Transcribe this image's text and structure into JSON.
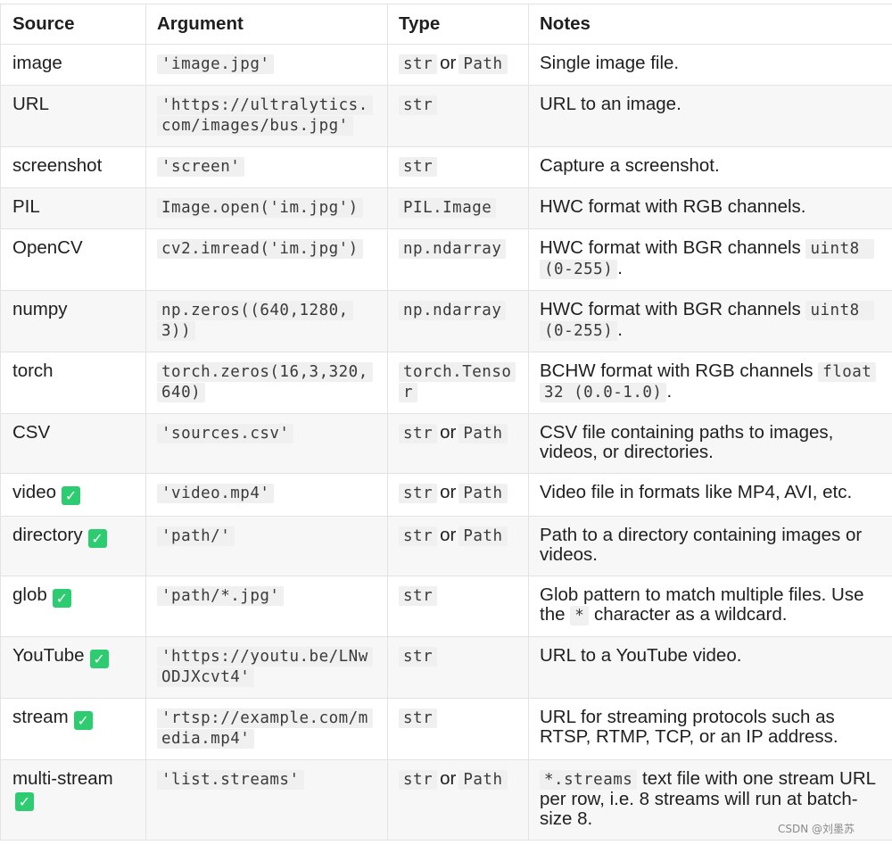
{
  "table": {
    "headers": [
      "Source",
      "Argument",
      "Type",
      "Notes"
    ],
    "or_word": "or",
    "rows": [
      {
        "source": "image",
        "argument": "'image.jpg'",
        "types": [
          "str",
          "Path"
        ],
        "notes": [
          {
            "t": "text",
            "v": "Single image file."
          }
        ]
      },
      {
        "source": "URL",
        "argument": "'https://ultralytics.com/images/bus.jpg'",
        "types": [
          "str"
        ],
        "notes": [
          {
            "t": "text",
            "v": "URL to an image."
          }
        ]
      },
      {
        "source": "screenshot",
        "argument": "'screen'",
        "types": [
          "str"
        ],
        "notes": [
          {
            "t": "text",
            "v": "Capture a screenshot."
          }
        ]
      },
      {
        "source": "PIL",
        "argument": "Image.open('im.jpg')",
        "types": [
          "PIL.Image"
        ],
        "notes": [
          {
            "t": "text",
            "v": "HWC format with RGB channels."
          }
        ]
      },
      {
        "source": "OpenCV",
        "argument": "cv2.imread('im.jpg')",
        "types": [
          "np.ndarray"
        ],
        "notes": [
          {
            "t": "text",
            "v": "HWC format with BGR channels "
          },
          {
            "t": "code",
            "v": "uint8 (0-255)"
          },
          {
            "t": "text",
            "v": "."
          }
        ]
      },
      {
        "source": "numpy",
        "argument": "np.zeros((640,1280,3))",
        "types": [
          "np.ndarray"
        ],
        "notes": [
          {
            "t": "text",
            "v": "HWC format with BGR channels "
          },
          {
            "t": "code",
            "v": "uint8 (0-255)"
          },
          {
            "t": "text",
            "v": "."
          }
        ]
      },
      {
        "source": "torch",
        "argument": "torch.zeros(16,3,320,640)",
        "types": [
          "torch.Tensor"
        ],
        "notes": [
          {
            "t": "text",
            "v": "BCHW format with RGB channels "
          },
          {
            "t": "code",
            "v": "float32 (0.0-1.0)"
          },
          {
            "t": "text",
            "v": "."
          }
        ]
      },
      {
        "source": "CSV",
        "argument": "'sources.csv'",
        "types": [
          "str",
          "Path"
        ],
        "notes": [
          {
            "t": "text",
            "v": "CSV file containing paths to images, videos, or directories."
          }
        ]
      },
      {
        "source": "video",
        "check": true,
        "argument": "'video.mp4'",
        "types": [
          "str",
          "Path"
        ],
        "notes": [
          {
            "t": "text",
            "v": "Video file in formats like MP4, AVI, etc."
          }
        ]
      },
      {
        "source": "directory",
        "check": true,
        "argument": "'path/'",
        "types": [
          "str",
          "Path"
        ],
        "notes": [
          {
            "t": "text",
            "v": "Path to a directory containing images or videos."
          }
        ]
      },
      {
        "source": "glob",
        "check": true,
        "argument": "'path/*.jpg'",
        "types": [
          "str"
        ],
        "notes": [
          {
            "t": "text",
            "v": "Glob pattern to match multiple files. Use the "
          },
          {
            "t": "code",
            "v": "*"
          },
          {
            "t": "text",
            "v": " character as a wildcard."
          }
        ]
      },
      {
        "source": "YouTube",
        "check": true,
        "argument": "'https://youtu.be/LNwODJXcvt4'",
        "types": [
          "str"
        ],
        "notes": [
          {
            "t": "text",
            "v": "URL to a YouTube video."
          }
        ]
      },
      {
        "source": "stream",
        "check": true,
        "argument": "'rtsp://example.com/media.mp4'",
        "types": [
          "str"
        ],
        "notes": [
          {
            "t": "text",
            "v": "URL for streaming protocols such as RTSP, RTMP, TCP, or an IP address."
          }
        ]
      },
      {
        "source": "multi-stream",
        "check": true,
        "check_block": true,
        "argument": "'list.streams'",
        "types": [
          "str",
          "Path"
        ],
        "notes": [
          {
            "t": "code",
            "v": "*.streams"
          },
          {
            "t": "text",
            "v": " text file with one stream URL per row, i.e. 8 streams will run at batch-size 8."
          }
        ]
      }
    ]
  },
  "check_icon": {
    "name": "checkmark-icon",
    "glyph": "✓",
    "color": "#2ecc71"
  },
  "watermark": "CSDN @刘墨苏"
}
